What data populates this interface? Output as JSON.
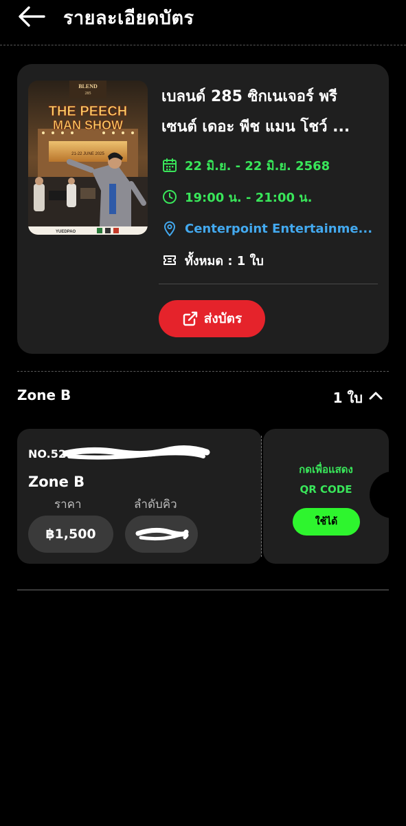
{
  "header": {
    "title": "รายละเอียดบัตร",
    "back_icon": "arrow-left-icon"
  },
  "event": {
    "title_line1": "เบลนด์ 285 ซิกเนเจอร์ พรี",
    "title_line2": "เซนต์ เดอะ พีช แมน โชว์ ...",
    "date": "22 มิ.ย. - 22 มิ.ย. 2568",
    "time": "19:00 น. - 21:00 น.",
    "venue": "Centerpoint Entertainme...",
    "quantity": "ทั้งหมด : 1 ใบ",
    "send_label": "ส่งบัตร",
    "poster": {
      "brand": "BLEND",
      "brand_sub": "285",
      "title_line1": "THE PEECH",
      "title_line2": "MAN SHOW",
      "marquee": "21-22 JUNE 2025",
      "sponsor": "YUEDPAO"
    },
    "colors": {
      "green": "#39e65a",
      "blue": "#43a9ef",
      "red": "#e5232b"
    }
  },
  "zone": {
    "name": "Zone B",
    "count": "1 ใบ",
    "expand_icon": "chevron-up-icon"
  },
  "ticket": {
    "number_prefix": "NO.52",
    "zone": "Zone B",
    "price_label": "ราคา",
    "queue_label": "ลำดับคิว",
    "price": "฿1,500",
    "tap_line1": "กดเพื่อแสดง",
    "tap_line2": "QR CODE",
    "status": "ใช้ได้"
  }
}
